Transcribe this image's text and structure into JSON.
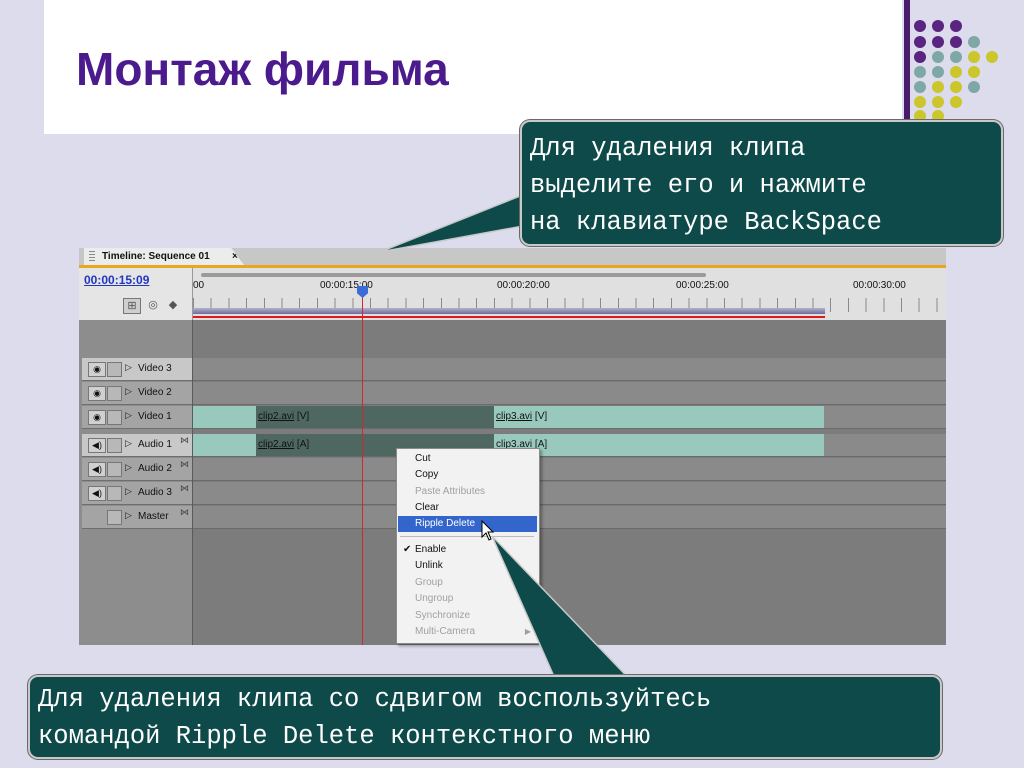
{
  "slide": {
    "title": "Монтаж фильма",
    "callout_top": "Для удаления клипа\nвыделите его и нажмите\nна клавиатуре BackSpace",
    "callout_bottom": "Для удаления клипа со сдвигом воспользуйтесь\nкомандой Ripple Delete контекстного меню"
  },
  "timeline": {
    "tab_label": "Timeline: Sequence 01",
    "tab_close": "×",
    "current_time": "00:00:15:09",
    "ruler_labels": [
      "00",
      "00:00:15:00",
      "00:00:20:00",
      "00:00:25:00",
      "00:00:30:00"
    ],
    "tracks": [
      {
        "name": "Video 3",
        "kind": "video"
      },
      {
        "name": "Video 2",
        "kind": "video"
      },
      {
        "name": "Video 1",
        "kind": "video"
      },
      {
        "name": "Audio 1",
        "kind": "audio"
      },
      {
        "name": "Audio 2",
        "kind": "audio"
      },
      {
        "name": "Audio 3",
        "kind": "audio"
      },
      {
        "name": "Master",
        "kind": "master"
      }
    ],
    "clips": {
      "v1_a": "clip2.avi",
      "v1_a_tag": " [V]",
      "v1_b": "clip3.avi",
      "v1_b_tag": " [V]",
      "a1_a": "clip2.avi",
      "a1_a_tag": " [A]",
      "a1_b": "clip3.avi",
      "a1_b_tag": " [A]"
    }
  },
  "context_menu": {
    "items": [
      {
        "label": "Cut",
        "enabled": true
      },
      {
        "label": "Copy",
        "enabled": true
      },
      {
        "label": "Paste Attributes",
        "enabled": false
      },
      {
        "label": "Clear",
        "enabled": true
      },
      {
        "label": "Ripple Delete",
        "enabled": true,
        "selected": true
      },
      {
        "label": "Enable",
        "enabled": true,
        "checked": true
      },
      {
        "label": "Unlink",
        "enabled": true
      },
      {
        "label": "Group",
        "enabled": false
      },
      {
        "label": "Ungroup",
        "enabled": false
      },
      {
        "label": "Synchronize",
        "enabled": false
      },
      {
        "label": "Multi-Camera",
        "enabled": false,
        "submenu": true
      }
    ],
    "check_glyph": "✔",
    "submenu_glyph": "▶"
  },
  "colors": {
    "title": "#4b1a8c",
    "callout_bg": "#0e4a4a",
    "menu_highlight": "#3366cc",
    "timecode": "#2038c0"
  },
  "icons": [
    "eye-icon",
    "speaker-icon",
    "lock-toggle-icon",
    "expand-triangle-icon",
    "keyframe-icon",
    "snap-icon",
    "marker-icon",
    "mouse-pointer-icon"
  ]
}
